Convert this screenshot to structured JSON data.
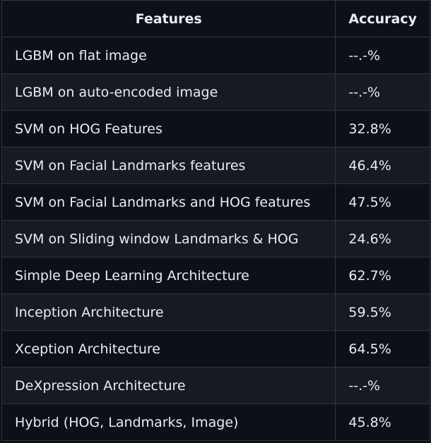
{
  "table": {
    "headers": [
      "Features",
      "Accuracy"
    ],
    "rows": [
      {
        "feature": "LGBM on flat image",
        "accuracy": "--.-%"
      },
      {
        "feature": "LGBM on auto-encoded image",
        "accuracy": "--.-%"
      },
      {
        "feature": "SVM on HOG Features",
        "accuracy": "32.8%"
      },
      {
        "feature": "SVM on Facial Landmarks features",
        "accuracy": "46.4%"
      },
      {
        "feature": "SVM on Facial Landmarks and HOG features",
        "accuracy": "47.5%"
      },
      {
        "feature": "SVM on Sliding window Landmarks & HOG",
        "accuracy": "24.6%"
      },
      {
        "feature": "Simple Deep Learning Architecture",
        "accuracy": "62.7%"
      },
      {
        "feature": "Inception Architecture",
        "accuracy": "59.5%"
      },
      {
        "feature": "Xception Architecture",
        "accuracy": "64.5%"
      },
      {
        "feature": "DeXpression Architecture",
        "accuracy": "--.-%"
      },
      {
        "feature": "Hybrid (HOG, Landmarks, Image)",
        "accuracy": "45.8%"
      }
    ]
  }
}
